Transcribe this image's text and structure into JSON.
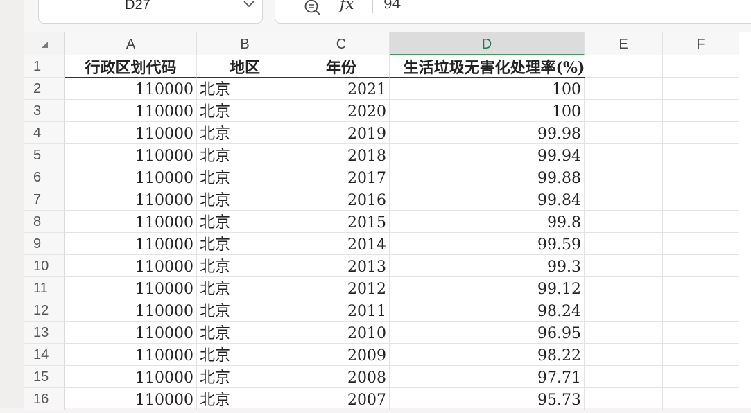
{
  "name_box": {
    "cell_ref": "D27"
  },
  "formula_bar": {
    "fx_label": "fx",
    "value": "94"
  },
  "columns": [
    "A",
    "B",
    "C",
    "D",
    "E",
    "F"
  ],
  "selected_column": "D",
  "header_row": {
    "row_number": "1",
    "cells": [
      "行政区划代码",
      "地区",
      "年份",
      "生活垃圾无害化处理率(%)"
    ]
  },
  "rows": [
    {
      "n": "2",
      "code": "110000",
      "region": "北京",
      "year": "2021",
      "rate": "100"
    },
    {
      "n": "3",
      "code": "110000",
      "region": "北京",
      "year": "2020",
      "rate": "100"
    },
    {
      "n": "4",
      "code": "110000",
      "region": "北京",
      "year": "2019",
      "rate": "99.98"
    },
    {
      "n": "5",
      "code": "110000",
      "region": "北京",
      "year": "2018",
      "rate": "99.94"
    },
    {
      "n": "6",
      "code": "110000",
      "region": "北京",
      "year": "2017",
      "rate": "99.88"
    },
    {
      "n": "7",
      "code": "110000",
      "region": "北京",
      "year": "2016",
      "rate": "99.84"
    },
    {
      "n": "8",
      "code": "110000",
      "region": "北京",
      "year": "2015",
      "rate": "99.8"
    },
    {
      "n": "9",
      "code": "110000",
      "region": "北京",
      "year": "2014",
      "rate": "99.59"
    },
    {
      "n": "10",
      "code": "110000",
      "region": "北京",
      "year": "2013",
      "rate": "99.3"
    },
    {
      "n": "11",
      "code": "110000",
      "region": "北京",
      "year": "2012",
      "rate": "99.12"
    },
    {
      "n": "12",
      "code": "110000",
      "region": "北京",
      "year": "2011",
      "rate": "98.24"
    },
    {
      "n": "13",
      "code": "110000",
      "region": "北京",
      "year": "2010",
      "rate": "96.95"
    },
    {
      "n": "14",
      "code": "110000",
      "region": "北京",
      "year": "2009",
      "rate": "98.22"
    },
    {
      "n": "15",
      "code": "110000",
      "region": "北京",
      "year": "2008",
      "rate": "97.71"
    },
    {
      "n": "16",
      "code": "110000",
      "region": "北京",
      "year": "2007",
      "rate": "95.73"
    }
  ]
}
